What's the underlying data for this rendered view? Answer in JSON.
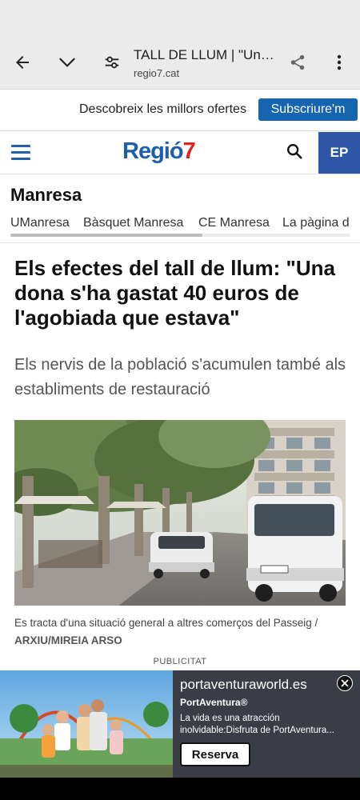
{
  "browser": {
    "title": "TALL DE LLUM | \"Una ...",
    "url": "regio7.cat",
    "icons": [
      "back-arrow-icon",
      "chevron-down-icon",
      "tune-icon",
      "share-icon",
      "more-vert-icon"
    ]
  },
  "offers_bar": {
    "text": "Descobreix les millors ofertes",
    "subscribe_label": "Subscriure'm"
  },
  "site_header": {
    "logo_text": "Regió",
    "logo_number": "7",
    "edition_label": "EP"
  },
  "section": {
    "title": "Manresa",
    "subnav": [
      "UManresa",
      "Bàsquet Manresa",
      "CE Manresa",
      "La pàgina d"
    ]
  },
  "article": {
    "headline": "Els efectes del tall de llum: \"Una dona s'ha gastat 40 euros de l'agobiada que estava\"",
    "subtitle": "Els nervis de la població s'acumulen també als establiments de restauració",
    "caption": "Es tracta d'una situació general a altres comerços del Passeig /",
    "credit": "ARXIU/MIREIA ARSO"
  },
  "ad": {
    "label": "PUBLICITAT",
    "domain": "portaventuraworld.es",
    "brand": "PortAventura®",
    "description": "La vida es una atracción inolvidable:Disfruta de PortAventura...",
    "cta": "Reserva"
  },
  "colors": {
    "brand_blue": "#1d5fa8",
    "brand_red": "#e0231c",
    "subscribe_blue": "#1565b0",
    "ep_blue": "#2e56a6"
  }
}
